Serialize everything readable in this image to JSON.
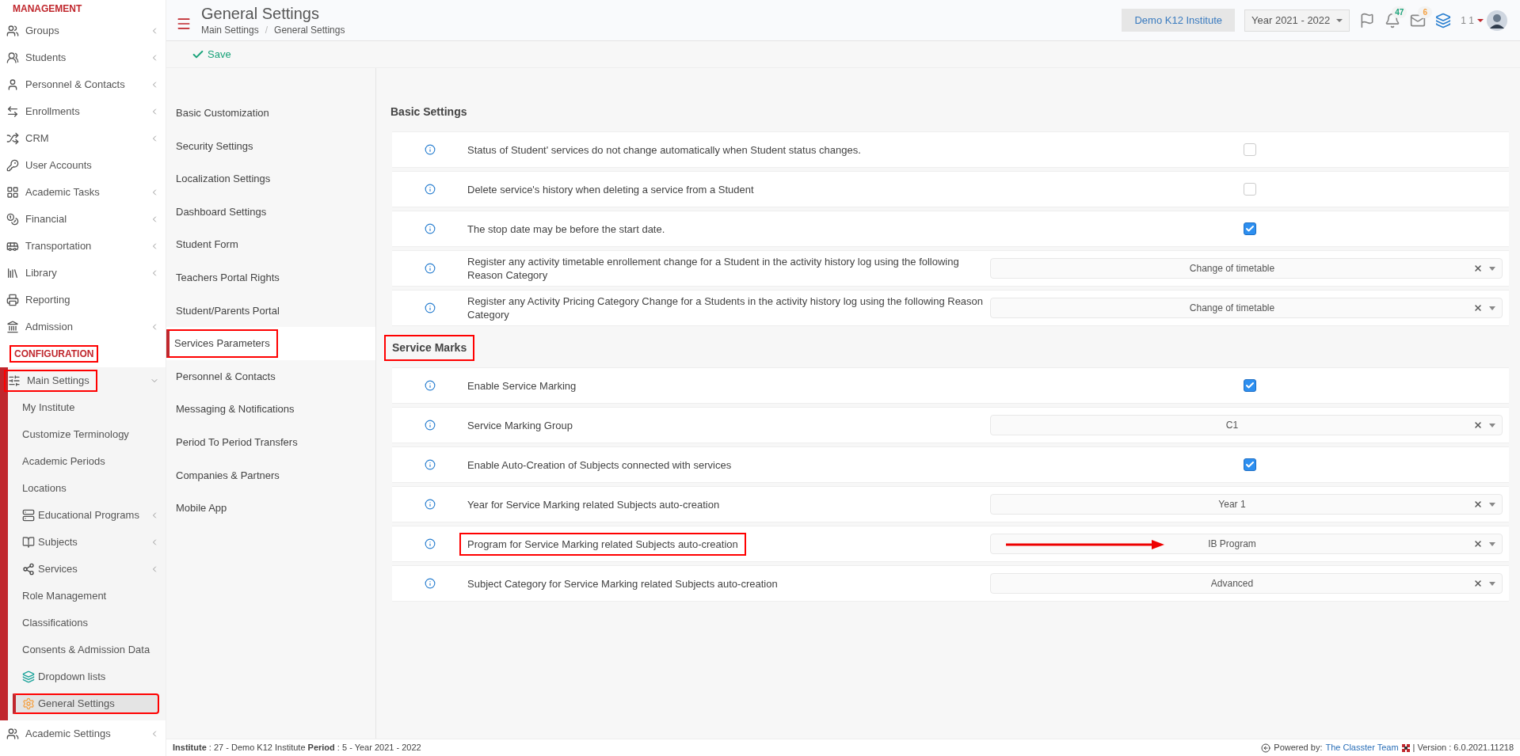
{
  "sidebar": {
    "sections": [
      {
        "title": "MANAGEMENT",
        "annotated": false,
        "items": [
          {
            "label": "Groups",
            "expanded": false
          },
          {
            "label": "Students",
            "expanded": false
          },
          {
            "label": "Personnel & Contacts",
            "expanded": false
          },
          {
            "label": "Enrollments",
            "expanded": false
          },
          {
            "label": "CRM",
            "expanded": false
          },
          {
            "label": "User Accounts"
          },
          {
            "label": "Academic Tasks",
            "expanded": false
          },
          {
            "label": "Financial",
            "expanded": false
          },
          {
            "label": "Transportation",
            "expanded": false
          },
          {
            "label": "Library",
            "expanded": false
          },
          {
            "label": "Reporting"
          },
          {
            "label": "Admission",
            "expanded": false
          }
        ]
      },
      {
        "title": "CONFIGURATION",
        "annotated": true,
        "items": [
          {
            "label": "Main Settings",
            "expanded": true,
            "annotated": true,
            "children": [
              {
                "label": "My Institute",
                "selected": false,
                "annotated": false
              },
              {
                "label": "Customize Terminology",
                "selected": false,
                "annotated": false
              },
              {
                "label": "Academic Periods",
                "selected": false,
                "annotated": false
              },
              {
                "label": "Locations",
                "selected": false,
                "annotated": false
              },
              {
                "label": "Educational Programs",
                "selected": false,
                "annotated": false,
                "expanded": false
              },
              {
                "label": "Subjects",
                "selected": false,
                "annotated": false,
                "expanded": false
              },
              {
                "label": "Services",
                "selected": false,
                "annotated": false,
                "expanded": false
              },
              {
                "label": "Role Management",
                "selected": false,
                "annotated": false
              },
              {
                "label": "Classifications",
                "selected": false,
                "annotated": false
              },
              {
                "label": "Consents & Admission Data",
                "selected": false,
                "annotated": false
              },
              {
                "label": "Dropdown lists",
                "selected": false,
                "annotated": false
              },
              {
                "label": "General Settings",
                "selected": true,
                "annotated": true
              }
            ]
          },
          {
            "label": "Academic Settings",
            "expanded": false
          }
        ]
      }
    ]
  },
  "header": {
    "title": "General Settings",
    "breadcrumb": [
      "Main Settings",
      "General Settings"
    ],
    "breadcrumb_separator": "/",
    "institute": "Demo K12 Institute",
    "year": "Year 2021 - 2022",
    "notifications": "47",
    "messages": "6",
    "user": "1 1"
  },
  "toolbar": {
    "save": "Save"
  },
  "settings_nav": [
    {
      "label": "Basic Customization",
      "selected": false,
      "annotated": false
    },
    {
      "label": "Security Settings",
      "selected": false,
      "annotated": false
    },
    {
      "label": "Localization Settings",
      "selected": false,
      "annotated": false
    },
    {
      "label": "Dashboard Settings",
      "selected": false,
      "annotated": false
    },
    {
      "label": "Student Form",
      "selected": false,
      "annotated": false
    },
    {
      "label": "Teachers Portal Rights",
      "selected": false,
      "annotated": false
    },
    {
      "label": "Student/Parents Portal",
      "selected": false,
      "annotated": false
    },
    {
      "label": "Services Parameters",
      "selected": true,
      "annotated": true
    },
    {
      "label": "Personnel & Contacts",
      "selected": false,
      "annotated": false
    },
    {
      "label": "Messaging & Notifications",
      "selected": false,
      "annotated": false
    },
    {
      "label": "Period To Period Transfers",
      "selected": false,
      "annotated": false
    },
    {
      "label": "Companies & Partners",
      "selected": false,
      "annotated": false
    },
    {
      "label": "Mobile App",
      "selected": false,
      "annotated": false
    }
  ],
  "groups": [
    {
      "title": "Basic Settings",
      "annotated": false,
      "rows": [
        {
          "kind": "checkbox",
          "label": "Status of Student' services do not change automatically when Student status changes.",
          "checked": false,
          "annotated": false
        },
        {
          "kind": "checkbox",
          "label": "Delete service's history when deleting a service from a Student",
          "checked": false,
          "annotated": false
        },
        {
          "kind": "checkbox",
          "label": "The stop date may be before the start date.",
          "checked": true,
          "annotated": false
        },
        {
          "kind": "select",
          "label": "Register any activity timetable enrollement change for a Student in the activity history log using the following Reason Category",
          "value": "Change of timetable",
          "annotated": false,
          "arrow": false
        },
        {
          "kind": "select",
          "label": "Register any Activity Pricing Category Change for a Students in the activity history log using the following Reason Category",
          "value": "Change of timetable",
          "annotated": false,
          "arrow": false
        }
      ]
    },
    {
      "title": "Service Marks",
      "annotated": true,
      "rows": [
        {
          "kind": "checkbox",
          "label": "Enable Service Marking",
          "checked": true,
          "annotated": false
        },
        {
          "kind": "select",
          "label": "Service Marking Group",
          "value": "C1",
          "annotated": false,
          "arrow": false
        },
        {
          "kind": "checkbox",
          "label": "Enable Auto-Creation of Subjects connected with services",
          "checked": true,
          "annotated": false
        },
        {
          "kind": "select",
          "label": "Year for Service Marking related Subjects auto-creation",
          "value": "Year 1",
          "annotated": false,
          "arrow": false
        },
        {
          "kind": "select",
          "label": "Program for Service Marking related Subjects auto-creation",
          "value": "IB Program",
          "annotated": true,
          "arrow": true
        },
        {
          "kind": "select",
          "label": "Subject Category for Service Marking related Subjects auto-creation",
          "value": "Advanced",
          "annotated": false,
          "arrow": false
        }
      ]
    }
  ],
  "footer": {
    "info": "**Institute** : 27 - Demo K12 Institute **Period** : 5 - Year 2021 - 2022",
    "powered": "Powered by:",
    "link": "The Classter Team",
    "version": "| Version : 6.0.2021.11218"
  }
}
